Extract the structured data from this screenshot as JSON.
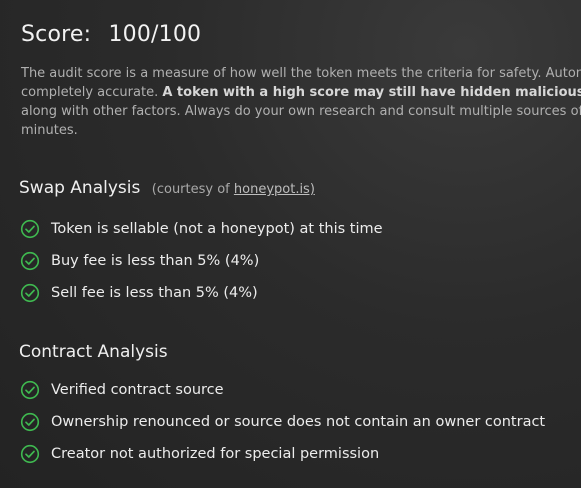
{
  "score": {
    "label": "Score:",
    "value": "100/100"
  },
  "description": {
    "line1": "The audit score is a measure of how well the token meets the criteria for safety.  Automated scanners like this one are not always",
    "line2_plain": "completely accurate.",
    "line2_bold": "A token with a high score may still have hidden malicious code.",
    "line3": "along with other factors. Always do your own research and consult multiple sources of information. This page is refreshed every few",
    "line4": "minutes."
  },
  "swap_analysis": {
    "title": "Swap Analysis",
    "courtesy_prefix": "(courtesy of",
    "courtesy_link": "honeypot.is)",
    "items": [
      "Token is sellable (not a honeypot) at this time",
      "Buy fee is less than 5% (4%)",
      "Sell fee is less than 5% (4%)"
    ]
  },
  "contract_analysis": {
    "title": "Contract Analysis",
    "items": [
      "Verified contract source",
      "Ownership renounced or source does not contain an owner contract",
      "Creator not authorized for special permission"
    ]
  },
  "colors": {
    "background": "#262626",
    "check_green": "#3fb950",
    "text": "#ececec",
    "muted_text": "#b0b0b0"
  },
  "icons": {
    "check": "check-circle-icon"
  }
}
